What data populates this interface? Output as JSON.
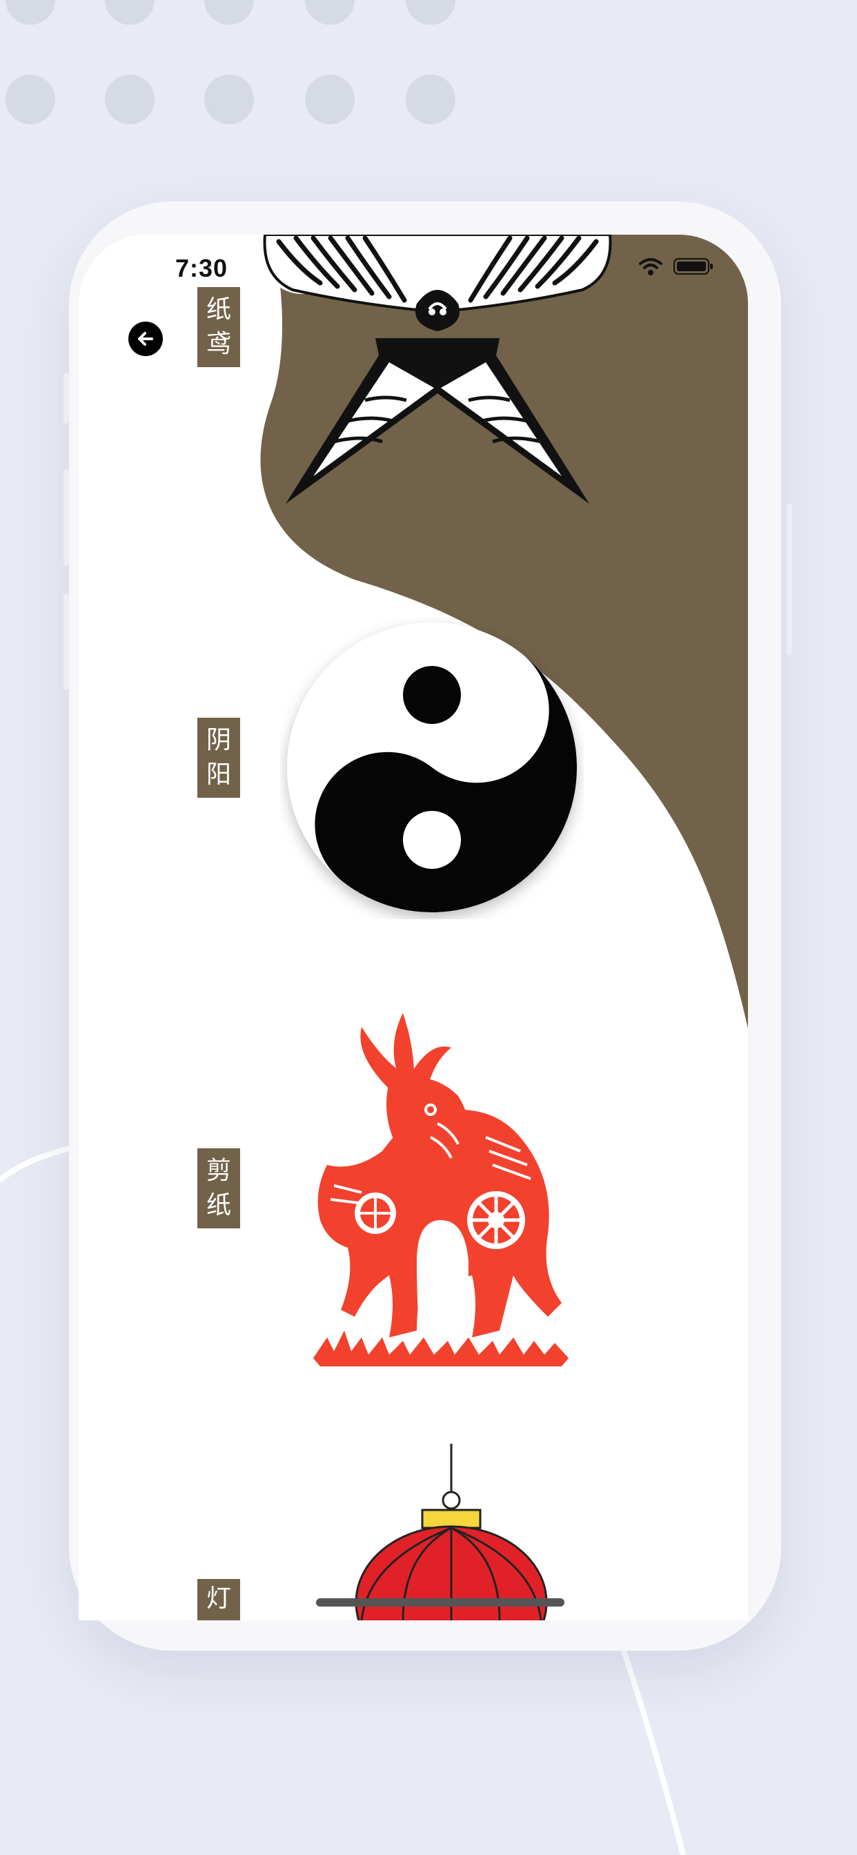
{
  "status_bar": {
    "time": "7:30"
  },
  "navigation": {
    "back_icon": "arrow-left-icon"
  },
  "items": [
    {
      "label_chars": [
        "纸",
        "鸢"
      ],
      "art": "paper-kite"
    },
    {
      "label_chars": [
        "阴",
        "阳"
      ],
      "art": "yin-yang"
    },
    {
      "label_chars": [
        "剪",
        "纸"
      ],
      "art": "paper-cut-goat"
    },
    {
      "label_chars": [
        "灯"
      ],
      "art": "red-lantern"
    }
  ],
  "colors": {
    "brown_accent": "#72624a",
    "background": "#e8ebf4",
    "paper_cut_red": "#f2412d",
    "lantern_red": "#e02228",
    "lantern_gold": "#f5d63b"
  }
}
